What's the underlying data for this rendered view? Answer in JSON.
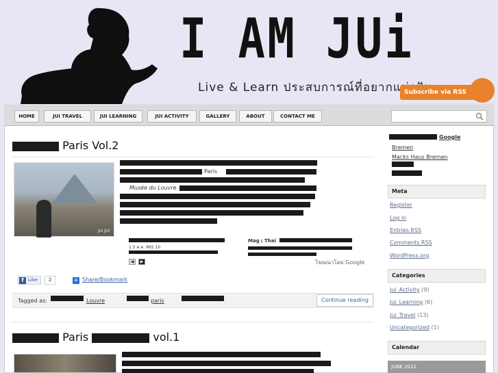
{
  "header": {
    "site_title": "I AM JUi",
    "tagline": "Live & Learn   ประสบการณ์ที่อยากแบ่งปัน",
    "rss_label": "Subscribe via RSS"
  },
  "nav": {
    "items": [
      "HOME",
      "JUI TRAVEL",
      "JUI LEARNING",
      "JUI ACTIVITY",
      "GALLERY",
      "ABOUT",
      "CONTACT ME"
    ],
    "search_placeholder": ""
  },
  "posts": [
    {
      "title_suffix": "Paris Vol.2",
      "image_caption": "Jui JUi",
      "inline_words": [
        "Paris",
        "Musée du Louvre"
      ],
      "ad_left": "1.5 ต.ค.  665  10",
      "ad_right": "Mag เ Thai",
      "ads_by": "โฆษณาโดย Google",
      "fb_like": "Like",
      "fb_count": "2",
      "share": "Share/Bookmark",
      "tagged_label": "Tagged as:",
      "tags": [
        "Louvre",
        "paris",
        ""
      ],
      "continue": "Continue reading"
    },
    {
      "title_middle": "Paris",
      "title_suffix": "vol.1"
    }
  ],
  "sidebar": {
    "google_label": "Google",
    "top_links": [
      "Bremen",
      "Macks Haus Bremen",
      ""
    ],
    "meta_title": "Meta",
    "meta_links": [
      "Register",
      "Log in",
      "Entries RSS",
      "Comments RSS",
      "WordPress.org"
    ],
    "categories_title": "Categories",
    "categories": [
      {
        "name": "Jui_Activity",
        "count": "(9)"
      },
      {
        "name": "Jui_Learning",
        "count": "(6)"
      },
      {
        "name": "Jui_Travel",
        "count": "(13)"
      },
      {
        "name": "Uncategorized",
        "count": "(1)"
      }
    ],
    "calendar_title": "Calendar",
    "calendar_month": "JUNE 2011"
  },
  "colors": {
    "background": "#e8e6f4",
    "rss": "#e9822c",
    "link": "#3a62a8"
  }
}
